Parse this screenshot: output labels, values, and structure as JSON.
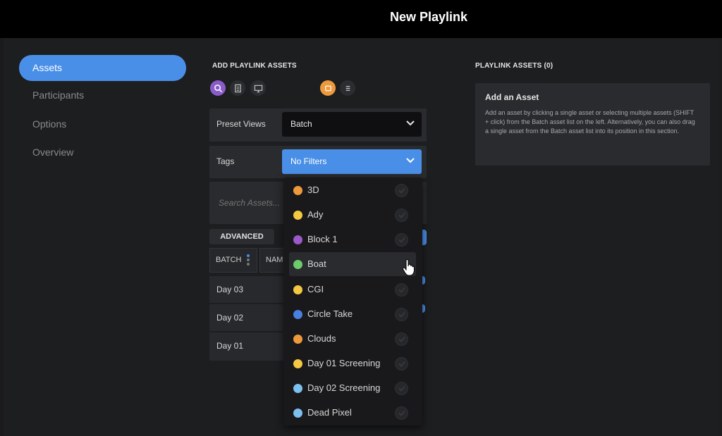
{
  "window": {
    "title": "New Playlink"
  },
  "sidebar": {
    "items": [
      {
        "label": "Assets",
        "active": true
      },
      {
        "label": "Participants",
        "active": false
      },
      {
        "label": "Options",
        "active": false
      },
      {
        "label": "Overview",
        "active": false
      }
    ]
  },
  "left_panel": {
    "title": "ADD PLAYLINK ASSETS",
    "view_icons": [
      "search-icon",
      "document-icon",
      "monitor-icon"
    ],
    "layout_icons": [
      "grid-view-icon",
      "list-view-icon"
    ],
    "preset_views": {
      "label": "Preset Views",
      "value": "Batch"
    },
    "tags": {
      "label": "Tags",
      "value": "No Filters"
    },
    "search": {
      "placeholder": "Search Assets..."
    },
    "advanced_label": "ADVANCED",
    "columns": [
      {
        "label": "BATCH"
      },
      {
        "label": "NAM"
      }
    ],
    "batches": [
      {
        "label": "Day 03"
      },
      {
        "label": "Day 02"
      },
      {
        "label": "Day 01"
      }
    ]
  },
  "tags_dropdown": {
    "items": [
      {
        "label": "3D",
        "color": "#ee9a3c"
      },
      {
        "label": "Ady",
        "color": "#f4c842"
      },
      {
        "label": "Block 1",
        "color": "#9b59c9"
      },
      {
        "label": "Boat",
        "color": "#6ccb6c",
        "hovered": true
      },
      {
        "label": "CGI",
        "color": "#f4c842"
      },
      {
        "label": "Circle Take",
        "color": "#4a7fe0"
      },
      {
        "label": "Clouds",
        "color": "#ee9a3c"
      },
      {
        "label": "Day 01 Screening",
        "color": "#f4c842"
      },
      {
        "label": "Day 02 Screening",
        "color": "#7cc0f0"
      },
      {
        "label": "Dead Pixel",
        "color": "#7cc0f0"
      }
    ]
  },
  "right_panel": {
    "title": "PLAYLINK ASSETS (0)",
    "empty_state": {
      "heading": "Add an Asset",
      "body": "Add an asset by clicking a single asset or selecting multiple assets (SHIFT + click) from the Batch asset list on the left. Alternatively, you can also drag a single asset from the Batch asset list into its position in this section."
    }
  }
}
